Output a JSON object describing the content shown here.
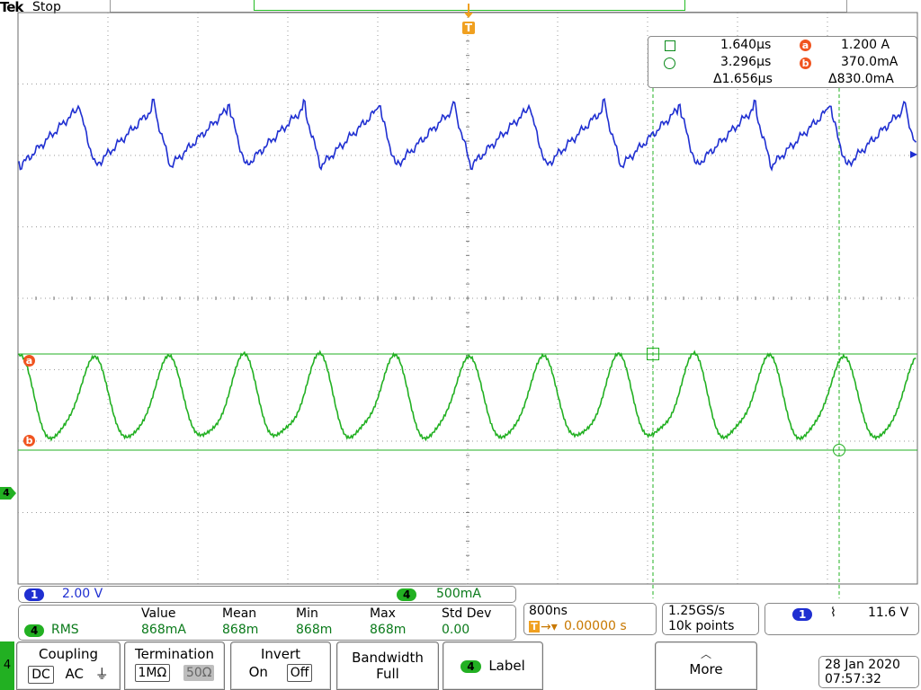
{
  "header": {
    "brand": "Tek",
    "run_state": "Stop"
  },
  "trigger_marker": "T",
  "channel_markers": {
    "ch4": "4"
  },
  "cursor_readout": {
    "row1": {
      "time": "1.640µs",
      "badge": "a",
      "value": "1.200 A"
    },
    "row2": {
      "time": "3.296µs",
      "badge": "b",
      "value": "370.0mA"
    },
    "row3": {
      "delta_time": "Δ1.656µs",
      "delta_value": "Δ830.0mA"
    }
  },
  "cursor_badges": {
    "a": "a",
    "b": "b"
  },
  "scale": {
    "ch1_label": "1",
    "ch1_value": "2.00 V",
    "ch4_label": "4",
    "ch4_value": "500mA"
  },
  "measurement": {
    "channel": "4",
    "type": "RMS",
    "headers": [
      "Value",
      "Mean",
      "Min",
      "Max",
      "Std Dev"
    ],
    "values": [
      "868mA",
      "868m",
      "868m",
      "868m",
      "0.00"
    ]
  },
  "timebase": {
    "scale": "800ns",
    "position": "0.00000 s",
    "trig_icon": "T"
  },
  "acquisition": {
    "rate": "1.25GS/s",
    "points": "10k points"
  },
  "trigger": {
    "source": "1",
    "slope_glyph": "⌇",
    "level": "11.6 V"
  },
  "softkeys": {
    "coupling": {
      "label": "Coupling",
      "opt_dc": "DC",
      "opt_ac": "AC",
      "opt_gnd": "⏚"
    },
    "termination": {
      "label": "Termination",
      "opt_1m": "1MΩ",
      "opt_50": "50Ω"
    },
    "invert": {
      "label": "Invert",
      "opt_on": "On",
      "opt_off": "Off"
    },
    "bandwidth": {
      "label": "Bandwidth",
      "value": "Full"
    },
    "label_key": {
      "chip": "4",
      "label": "Label"
    },
    "more": {
      "label": "More"
    },
    "channel_strip": "4"
  },
  "datetime": {
    "date": "28 Jan  2020",
    "time": "07:57:32"
  },
  "colors": {
    "ch1": "#1f2fd1",
    "ch4": "#22b022",
    "trigger": "#f0a020",
    "cursor_badge": "#f0541f"
  },
  "icons": {
    "square-cursor": "square-cursor-icon",
    "circle-cursor": "circle-cursor-icon",
    "more": "chevron-up-icon"
  }
}
